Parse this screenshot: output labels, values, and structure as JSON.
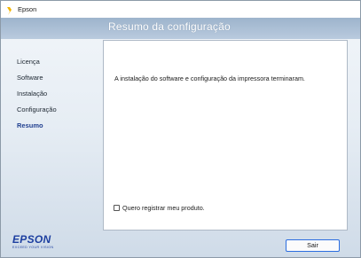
{
  "window": {
    "title": "Epson",
    "icon": "epson-app-icon"
  },
  "header": {
    "title": "Resumo da configuração"
  },
  "sidebar": {
    "items": [
      {
        "label": "Licença",
        "active": false
      },
      {
        "label": "Software",
        "active": false
      },
      {
        "label": "Instalação",
        "active": false
      },
      {
        "label": "Configuração",
        "active": false
      },
      {
        "label": "Resumo",
        "active": true
      }
    ]
  },
  "main": {
    "message": "A instalação do software e configuração da impressora terminaram.",
    "register_label": "Quero registrar meu produto.",
    "register_checked": false
  },
  "brand": {
    "name": "EPSON",
    "tagline": "EXCEED YOUR VISION"
  },
  "footer": {
    "exit_label": "Sair"
  },
  "colors": {
    "accent": "#1f3e8f",
    "brand_blue": "#1d3fa0",
    "button_border": "#2c6ee0",
    "header_band": "#9db4cc"
  }
}
